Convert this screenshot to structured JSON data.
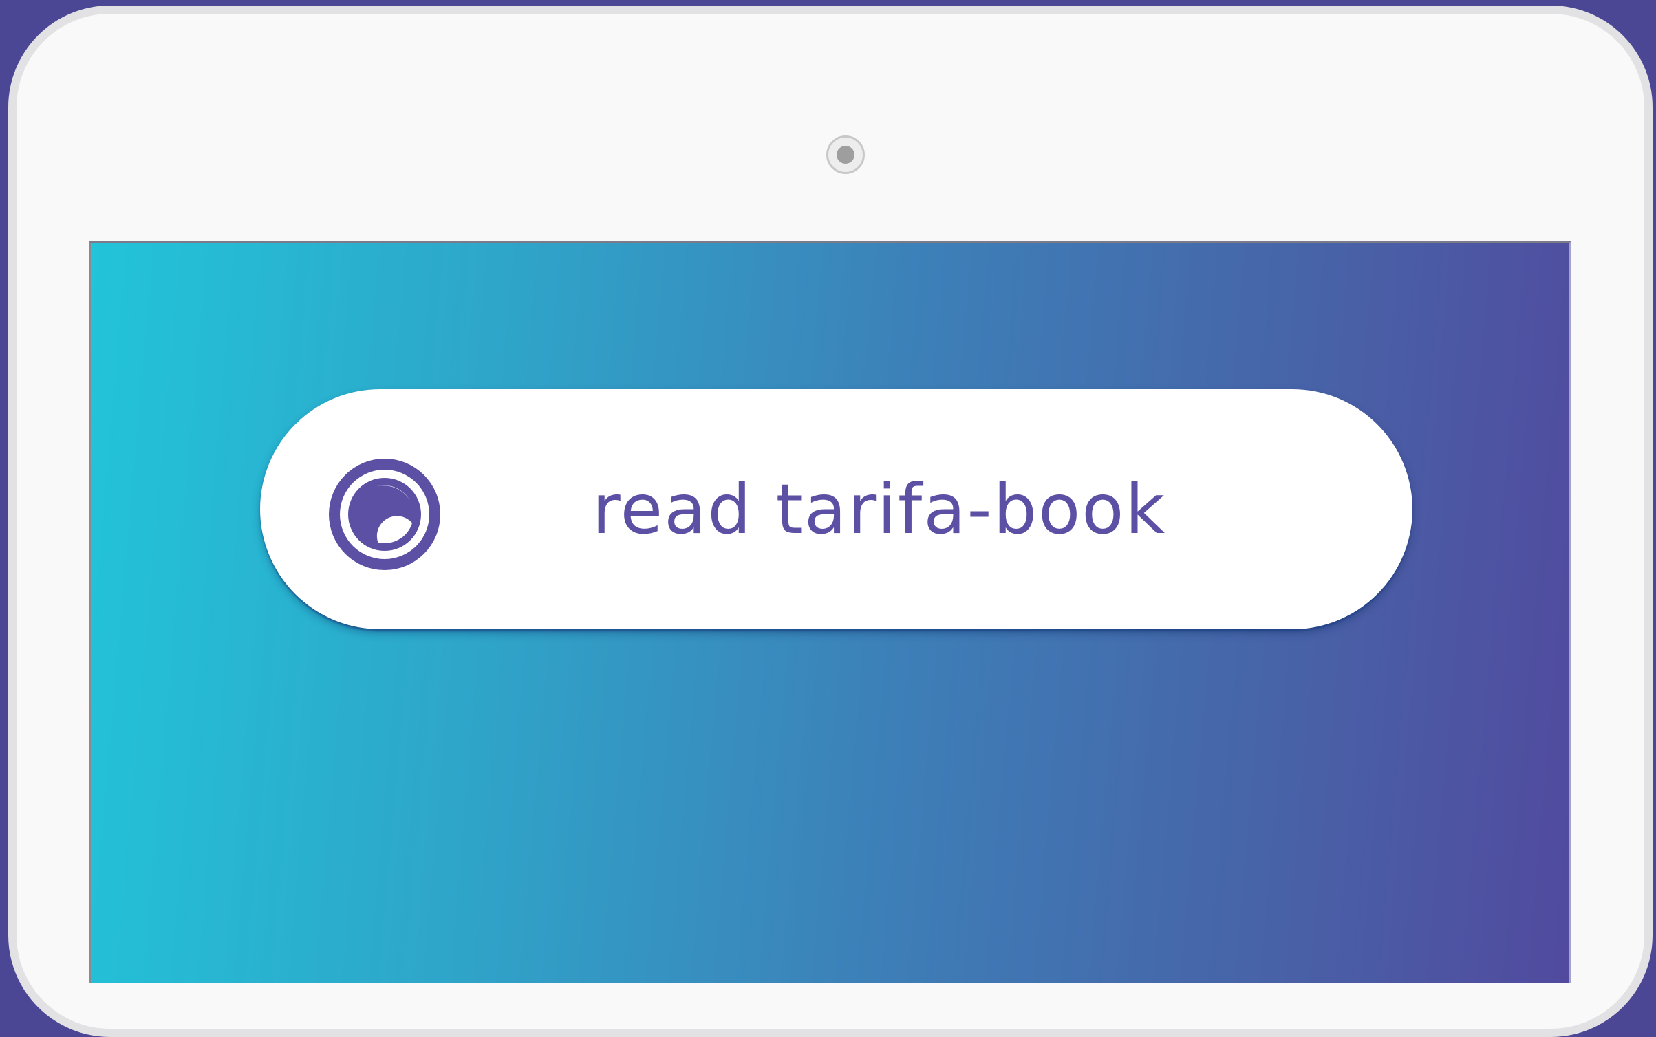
{
  "main_action": {
    "label": "read tarifa-book",
    "icon": "app-logo-icon"
  },
  "colors": {
    "brand_purple": "#5b50a4",
    "gradient_start": "#22c4d9",
    "gradient_end": "#514a9e",
    "page_background": "#4c4794"
  }
}
